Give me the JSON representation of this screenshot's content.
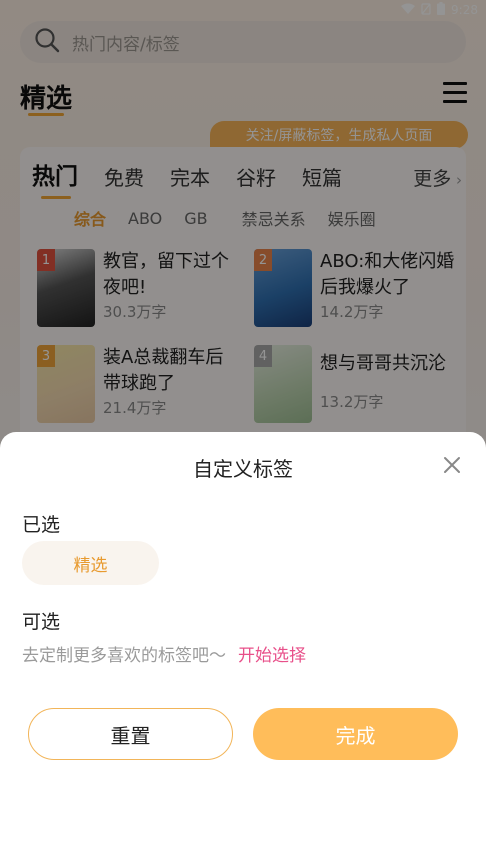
{
  "status": {
    "time": "9:28"
  },
  "search": {
    "placeholder": "热门内容/标签"
  },
  "header": {
    "title": "精选",
    "banner": "关注/屏蔽标签，生成私人页面"
  },
  "tabs": [
    "热门",
    "免费",
    "完本",
    "谷籽",
    "短篇"
  ],
  "tab_more": "更多",
  "subtabs": [
    "综合",
    "ABO",
    "GB",
    "禁忌关系",
    "娱乐圈"
  ],
  "books": [
    {
      "rank": "1",
      "title": "教官，留下过个夜吧!",
      "words": "30.3万字"
    },
    {
      "rank": "2",
      "title": "ABO:和大佬闪婚后我爆火了",
      "words": "14.2万字"
    },
    {
      "rank": "3",
      "title": "装A总裁翻车后带球跑了",
      "words": "21.4万字"
    },
    {
      "rank": "4",
      "title": "想与哥哥共沉沦",
      "words": "13.2万字"
    }
  ],
  "sheet": {
    "title": "自定义标签",
    "selected_label": "已选",
    "selected_chip": "精选",
    "optional_label": "可选",
    "hint": "去定制更多喜欢的标签吧～",
    "hint_link": "开始选择",
    "reset": "重置",
    "done": "完成"
  },
  "colors": {
    "accent": "#f2a534",
    "link": "#e8508a",
    "done_bg": "#ffbd5a"
  },
  "icons": [
    "wifi-icon",
    "battery-icon",
    "search-icon",
    "menu-icon",
    "close-icon"
  ]
}
